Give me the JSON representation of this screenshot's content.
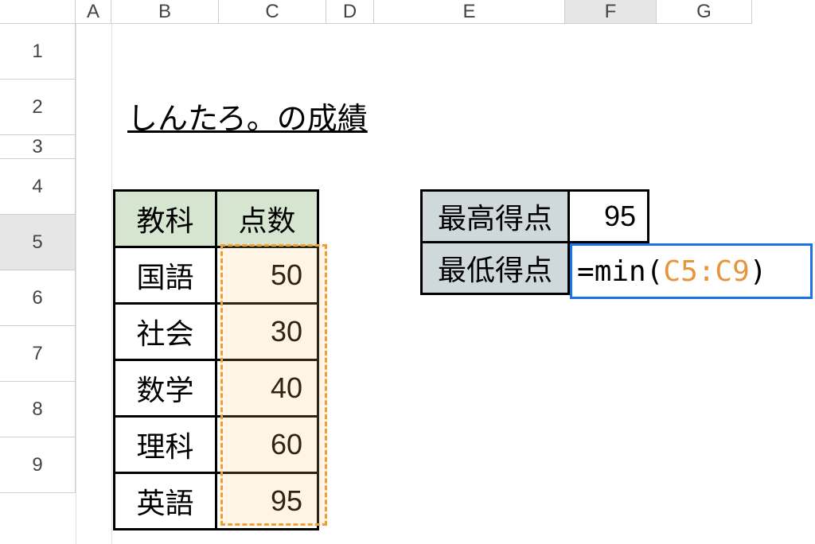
{
  "columns": [
    "A",
    "B",
    "C",
    "D",
    "E",
    "F",
    "G"
  ],
  "rows": [
    "1",
    "2",
    "3",
    "4",
    "5",
    "6",
    "7",
    "8",
    "9"
  ],
  "selected_column": "F",
  "selected_row": "5",
  "title": "しんたろ。の成績",
  "data_table": {
    "headers": [
      "教科",
      "点数"
    ],
    "rows": [
      {
        "subject": "国語",
        "score": "50"
      },
      {
        "subject": "社会",
        "score": "30"
      },
      {
        "subject": "数学",
        "score": "40"
      },
      {
        "subject": "理科",
        "score": "60"
      },
      {
        "subject": "英語",
        "score": "95"
      }
    ]
  },
  "summary": {
    "max_label": "最高得点",
    "max_value": "95",
    "min_label": "最低得点"
  },
  "formula": {
    "prefix": "=",
    "function": "min",
    "open": "(",
    "range": "C5:C9",
    "close": ")"
  },
  "selection_range": "C5:C9"
}
